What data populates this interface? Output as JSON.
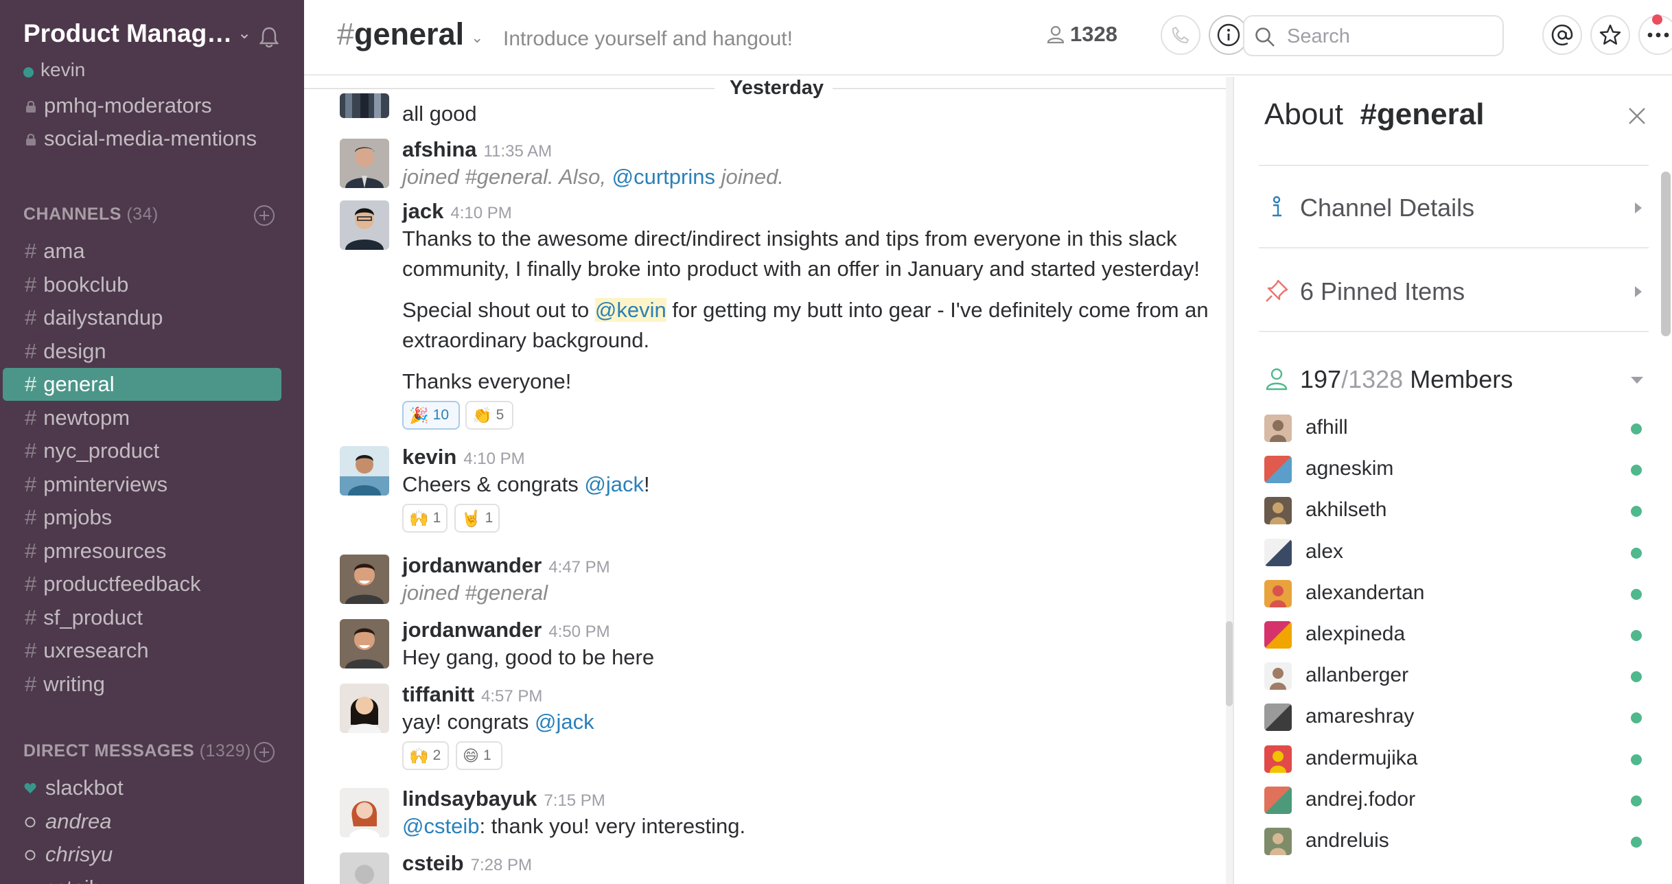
{
  "sidebar": {
    "team_name": "Product Manag…",
    "user": "kevin",
    "private_channels": [
      "pmhq-moderators",
      "social-media-mentions"
    ],
    "channels_heading": "CHANNELS",
    "channels_count": "(34)",
    "channels": [
      "ama",
      "bookclub",
      "dailystandup",
      "design",
      "general",
      "newtopm",
      "nyc_product",
      "pminterviews",
      "pmjobs",
      "pmresources",
      "productfeedback",
      "sf_product",
      "uxresearch",
      "writing"
    ],
    "active_channel": "general",
    "dm_heading": "DIRECT MESSAGES",
    "dm_count": "(1329)",
    "direct_messages": [
      {
        "name": "slackbot",
        "status": "heart"
      },
      {
        "name": "andrea",
        "status": "away"
      },
      {
        "name": "chrisyu",
        "status": "away"
      },
      {
        "name": "csteib",
        "status": "online"
      }
    ],
    "colors": {
      "background": "#4d394b",
      "active": "#4c9689",
      "presence": "#38978d"
    }
  },
  "header": {
    "channel_name": "general",
    "hash": "#",
    "topic": "Introduce yourself and hangout!",
    "member_count": "1328",
    "search_placeholder": "Search",
    "icons": [
      "person-icon",
      "phone-icon",
      "info-icon",
      "search-icon",
      "at-icon",
      "star-icon",
      "more-icon"
    ]
  },
  "messages": {
    "day_divider": "Yesterday",
    "items": [
      {
        "author": "",
        "time": "",
        "lines": [
          "all good"
        ]
      },
      {
        "author": "afshina",
        "time": "11:35 AM",
        "system": [
          "joined #general. Also, ",
          "@curtprins",
          " joined."
        ]
      },
      {
        "author": "jack",
        "time": "4:10 PM",
        "lines": [
          "Thanks to the awesome direct/indirect insights and tips from everyone in this slack",
          "community, I finally broke into product with an offer in January and started yesterday!"
        ],
        "shout": [
          "Special shout out to ",
          "@kevin",
          " for getting my butt into gear - I've definitely come from an"
        ],
        "shout2": "extraordinary background.",
        "closing": "Thanks everyone!",
        "reactions": [
          {
            "emoji": "🎉",
            "count": "10"
          },
          {
            "emoji": "👏",
            "count": "5"
          }
        ]
      },
      {
        "author": "kevin",
        "time": "4:10 PM",
        "text": [
          "Cheers & congrats ",
          "@jack",
          "!"
        ],
        "reactions": [
          {
            "emoji": "🙌",
            "count": "1"
          },
          {
            "emoji": "🤘",
            "count": "1"
          }
        ]
      },
      {
        "author": "jordanwander",
        "time": "4:47 PM",
        "system_text": "joined #general"
      },
      {
        "author": "jordanwander",
        "time": "4:50 PM",
        "text": "Hey gang, good to be here"
      },
      {
        "author": "tiffanitt",
        "time": "4:57 PM",
        "text": [
          "yay! congrats ",
          "@jack"
        ],
        "reactions": [
          {
            "emoji": "🙌",
            "count": "2"
          },
          {
            "emoji": "😄",
            "count": "1"
          }
        ]
      },
      {
        "author": "lindsaybayuk",
        "time": "7:15 PM",
        "text": [
          "@csteib",
          ": thank you! very interesting."
        ]
      },
      {
        "author": "csteib",
        "time": "7:28 PM"
      }
    ]
  },
  "flexpane": {
    "about_prefix": "About",
    "about_channel": "#general",
    "channel_details": "Channel Details",
    "pinned": "6 Pinned Items",
    "members_online": "197",
    "members_total": "/1328",
    "members_label": "Members",
    "members": [
      "afhill",
      "agneskim",
      "akhilseth",
      "alex",
      "alexandertan",
      "alexpineda",
      "allanberger",
      "amareshray",
      "andermujika",
      "andrej.fodor",
      "andreluis"
    ],
    "colors": {
      "online": "#4fb88c",
      "details": "#2a80b9",
      "pin": "#e8746c"
    }
  }
}
